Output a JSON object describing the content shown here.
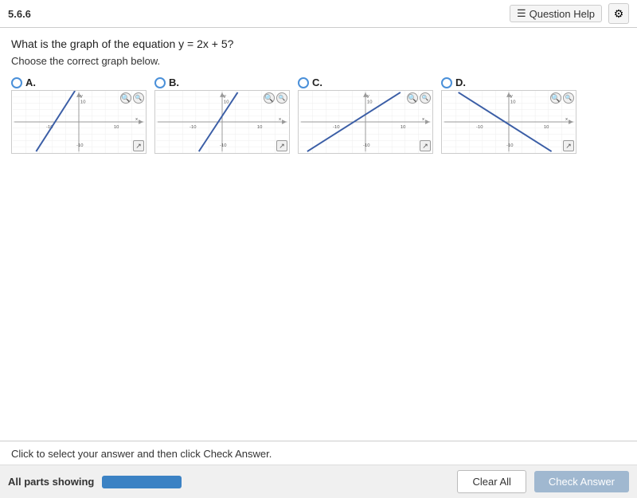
{
  "topbar": {
    "section": "5.6.6",
    "question_help": "Question Help",
    "gear_icon": "⚙"
  },
  "question": {
    "text": "What is the graph of the equation y = 2x + 5?",
    "instruction": "Choose the correct graph below."
  },
  "options": [
    {
      "id": "A",
      "label": "A.",
      "line_type": "steep_positive_left"
    },
    {
      "id": "B",
      "label": "B.",
      "line_type": "steep_positive_right"
    },
    {
      "id": "C",
      "label": "C.",
      "line_type": "moderate_positive"
    },
    {
      "id": "D",
      "label": "D.",
      "line_type": "steep_negative"
    }
  ],
  "bottom": {
    "hint": "Click to select your answer and then click Check Answer.",
    "all_parts_label": "All parts showing",
    "clear_all": "Clear All",
    "check_answer": "Check Answer"
  }
}
